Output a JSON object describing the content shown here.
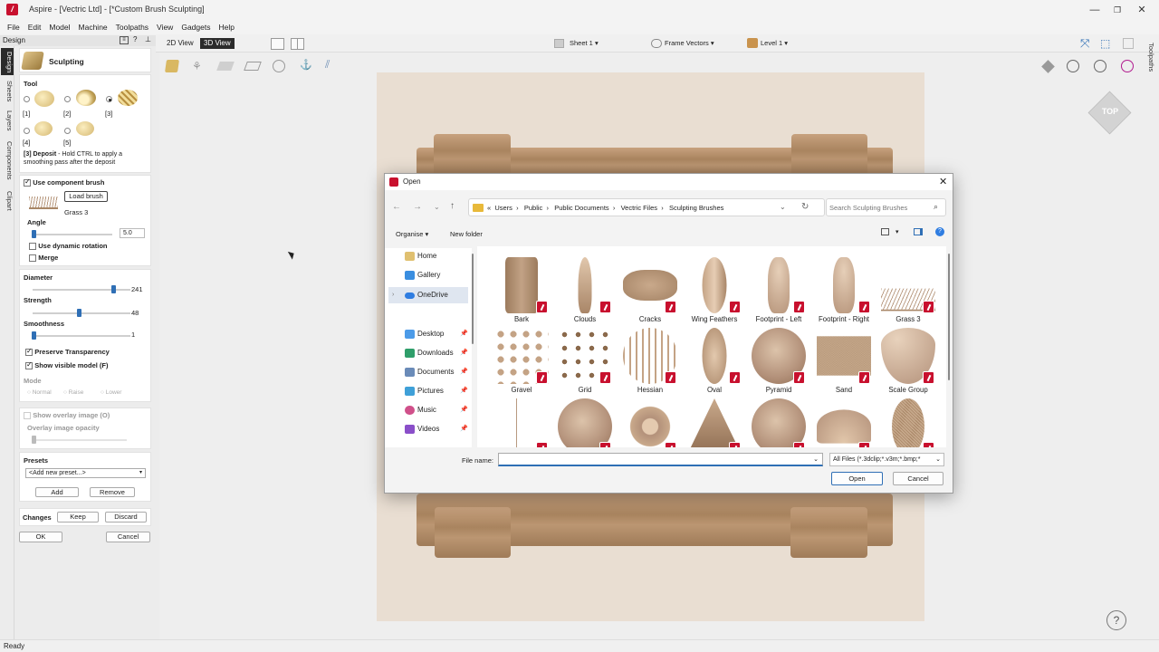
{
  "app": {
    "title": "Aspire - [Vectric Ltd] - [*Custom Brush Sculpting]",
    "menu": [
      "File",
      "Edit",
      "Model",
      "Machine",
      "Toolpaths",
      "View",
      "Gadgets",
      "Help"
    ],
    "status": "Ready",
    "window_buttons": [
      "—",
      "❐",
      "✕"
    ]
  },
  "toolbar": {
    "view2d": "2D View",
    "view3d": "3D View",
    "sheet": "Sheet 1",
    "frame_vectors": "Frame Vectors",
    "level": "Level 1"
  },
  "left_tabs": [
    "Design",
    "Sheets",
    "Layers",
    "Components",
    "Clipart"
  ],
  "right_tabs": [
    "Toolpaths"
  ],
  "panel": {
    "header": "Design",
    "title": "Sculpting",
    "tool_label": "Tool",
    "tools": [
      "[1]",
      "[2]",
      "[3]",
      "[4]",
      "[5]"
    ],
    "selected_tool": "[3]",
    "tool_desc_bold": "[3] Deposit",
    "tool_desc": " - Hold CTRL to apply a smoothing pass after the deposit",
    "use_component_brush": "Use component brush",
    "load_brush": "Load brush",
    "brush_name": "Grass 3",
    "angle_label": "Angle",
    "angle_value": "5.0",
    "dynamic_rotation": "Use dynamic rotation",
    "merge": "Merge",
    "diameter_label": "Diameter",
    "diameter_value": "241",
    "diameter_pct": 0.83,
    "strength_label": "Strength",
    "strength_value": "48",
    "strength_pct": 0.47,
    "smoothness_label": "Smoothness",
    "smoothness_value": "1",
    "smoothness_pct": 0.0,
    "preserve_transparency": "Preserve Transparency",
    "show_visible_model": "Show visible model (F)",
    "mode_label": "Mode",
    "modes": [
      "Normal",
      "Raise",
      "Lower"
    ],
    "show_overlay": "Show overlay image (O)",
    "overlay_opacity": "Overlay image opacity",
    "presets_label": "Presets",
    "preset_select": "<Add new preset...>",
    "add": "Add",
    "remove": "Remove",
    "changes_label": "Changes",
    "keep": "Keep",
    "discard": "Discard",
    "ok": "OK",
    "cancel": "Cancel"
  },
  "viewcube": "TOP",
  "dialog": {
    "title": "Open",
    "breadcrumb": [
      "«",
      "Users",
      "Public",
      "Public Documents",
      "Vectric Files",
      "Sculpting Brushes"
    ],
    "search_placeholder": "Search Sculpting Brushes",
    "organise": "Organise",
    "new_folder": "New folder",
    "nav": [
      "Home",
      "Gallery",
      "OneDrive",
      "Desktop",
      "Downloads",
      "Documents",
      "Pictures",
      "Music",
      "Videos"
    ],
    "files": [
      "Bark",
      "Clouds",
      "Cracks",
      "Wing Feathers",
      "Footprint - Left",
      "Footprint - Right",
      "Grass 3",
      "Gravel",
      "Grid",
      "Hessian",
      "Oval",
      "Pyramid",
      "Sand",
      "Scale Group",
      "",
      "",
      "",
      "",
      "",
      "",
      ""
    ],
    "filename_label": "File name:",
    "filename_value": "",
    "filetype": "All Files (*.3dclip;*.v3m;*.bmp;*",
    "open": "Open",
    "cancel": "Cancel"
  },
  "colors": {
    "accent": "#2f6fb5",
    "vectric_red": "#c8102e",
    "wood": "#b8967a"
  }
}
